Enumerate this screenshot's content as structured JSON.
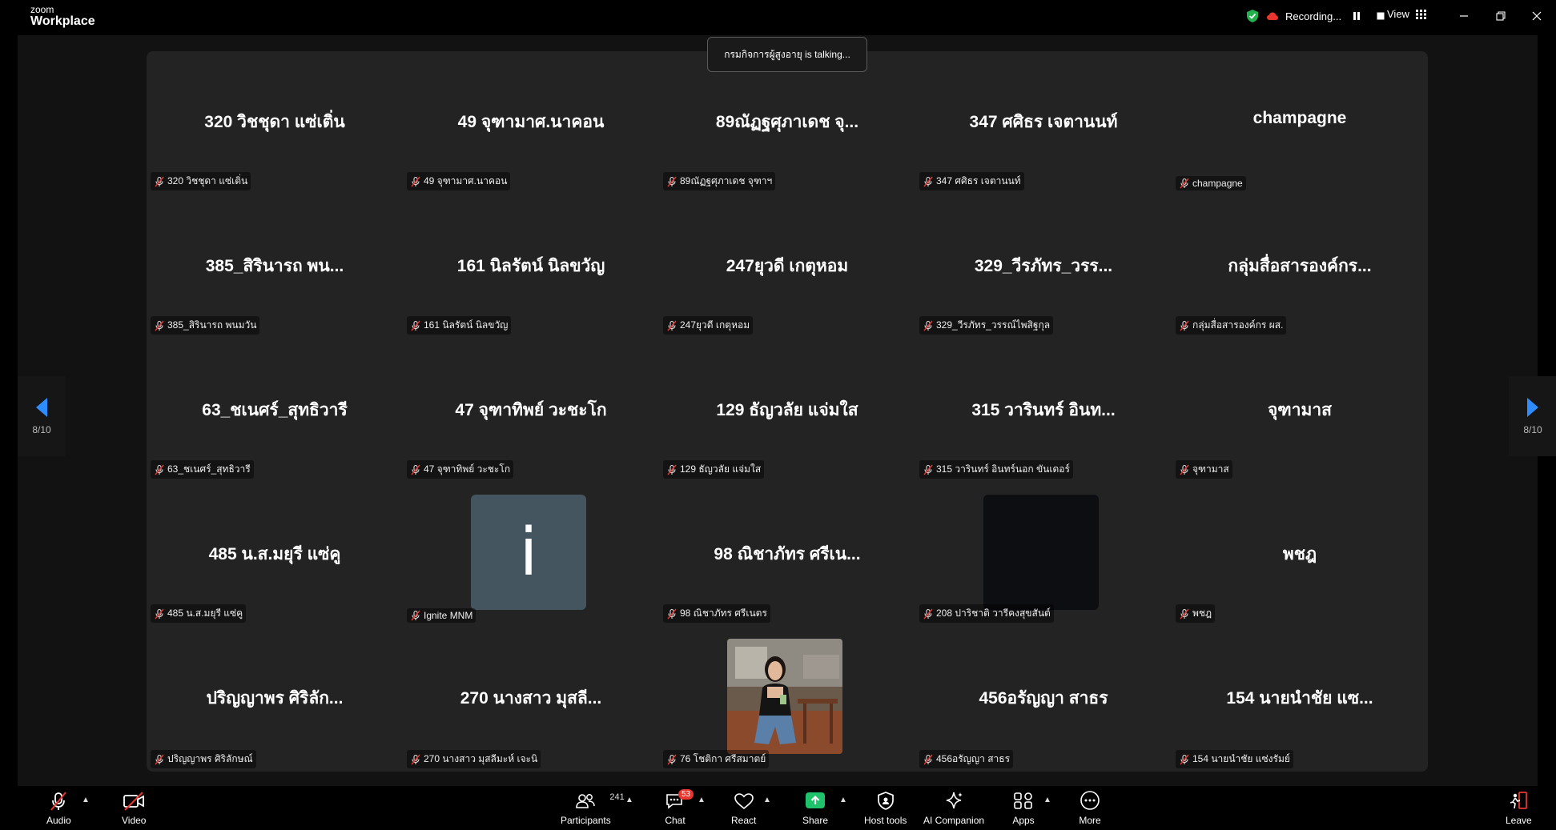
{
  "app": {
    "brand_small": "zoom",
    "brand_large": "Workplace"
  },
  "titlebar": {
    "recording_label": "Recording...",
    "view_label": "View"
  },
  "talking_banner": "กรมกิจการผู้สูงอายุ is talking...",
  "pager": {
    "left": "8/10",
    "right": "8/10"
  },
  "tiles": [
    {
      "big": "320 วิชชุดา แซ่เติ่น",
      "label": "320 วิชชุดา แซ่เติ่น",
      "kind": "name"
    },
    {
      "big": "49  จุฑามาศ.นาคอน",
      "label": "49  จุฑามาศ.นาคอน",
      "kind": "name"
    },
    {
      "big": "89ณัฏฐศุภาเดช จุ...",
      "label": "89ณัฏฐศุภาเดช จุฑาฯ",
      "kind": "name"
    },
    {
      "big": "347 ศศิธร เจตานนท์",
      "label": "347 ศศิธร เจตานนท์",
      "kind": "name"
    },
    {
      "big": "champagne",
      "label": "champagne",
      "kind": "name"
    },
    {
      "big": "385_สิรินารถ พน...",
      "label": "385_สิรินารถ พนมวัน",
      "kind": "name"
    },
    {
      "big": "161 นิลรัตน์ นิลขวัญ",
      "label": "161 นิลรัตน์ นิลขวัญ",
      "kind": "name"
    },
    {
      "big": "247ยุวดี เกตุหอม",
      "label": "247ยุวดี เกตุหอม",
      "kind": "name"
    },
    {
      "big": "329_วีรภัทร_วรร...",
      "label": "329_วีรภัทร_วรรณ์ไพสิฐกุล",
      "kind": "name"
    },
    {
      "big": "กลุ่มสื่อสารองค์กร...",
      "label": "กลุ่มสื่อสารองค์กร ผส.",
      "kind": "name"
    },
    {
      "big": "63_ชเนศร์_สุทธิวารี",
      "label": "63_ชเนศร์_สุทธิวารี",
      "kind": "name"
    },
    {
      "big": "47 จุฑาทิพย์ วะชะโก",
      "label": "47 จุฑาทิพย์ วะชะโก",
      "kind": "name"
    },
    {
      "big": "129 ธัญวลัย แจ่มใส",
      "label": "129 ธัญวลัย แจ่มใส",
      "kind": "name"
    },
    {
      "big": "315 วารินทร์ อินท...",
      "label": "315 วารินทร์ อินทร์นอก ขันเดอร์",
      "kind": "name"
    },
    {
      "big": "จุฑามาส",
      "label": "จุฑามาส",
      "kind": "name"
    },
    {
      "big": "485 น.ส.มยุรี แซ่คู",
      "label": "485 น.ส.มยุรี แซ่คู",
      "kind": "name"
    },
    {
      "big": "i",
      "label": "Ignite MNM",
      "kind": "letter"
    },
    {
      "big": "98 ณิชาภัทร ศรีเน...",
      "label": "98 ณิชาภัทร ศรีเนตร",
      "kind": "name"
    },
    {
      "big": "",
      "label": "208 ปาริชาติ วารีคงสุขสันต์",
      "kind": "dark"
    },
    {
      "big": "พชฎ",
      "label": "พชฎ",
      "kind": "name"
    },
    {
      "big": "ปริญญาพร ศิริลัก...",
      "label": "ปริญญาพร ศิริลักษณ์",
      "kind": "name"
    },
    {
      "big": "270 นางสาว มุสลี...",
      "label": "270 นางสาว มุสลีมะห์ เจะนิ",
      "kind": "name"
    },
    {
      "big": "",
      "label": "76 โชติกา ศรีสมาตย์",
      "kind": "photo"
    },
    {
      "big": "456อรัญญา สาธร",
      "label": "456อรัญญา สาธร",
      "kind": "name"
    },
    {
      "big": "154 นายนำชัย แซ...",
      "label": "154 นายนำชัย แซ่งรัมย์",
      "kind": "name"
    }
  ],
  "toolbar": {
    "audio": "Audio",
    "video": "Video",
    "participants": "Participants",
    "participants_count": "241",
    "chat": "Chat",
    "chat_badge": "53",
    "react": "React",
    "share": "Share",
    "host_tools": "Host tools",
    "ai_companion": "AI Companion",
    "apps": "Apps",
    "more": "More",
    "leave": "Leave"
  }
}
